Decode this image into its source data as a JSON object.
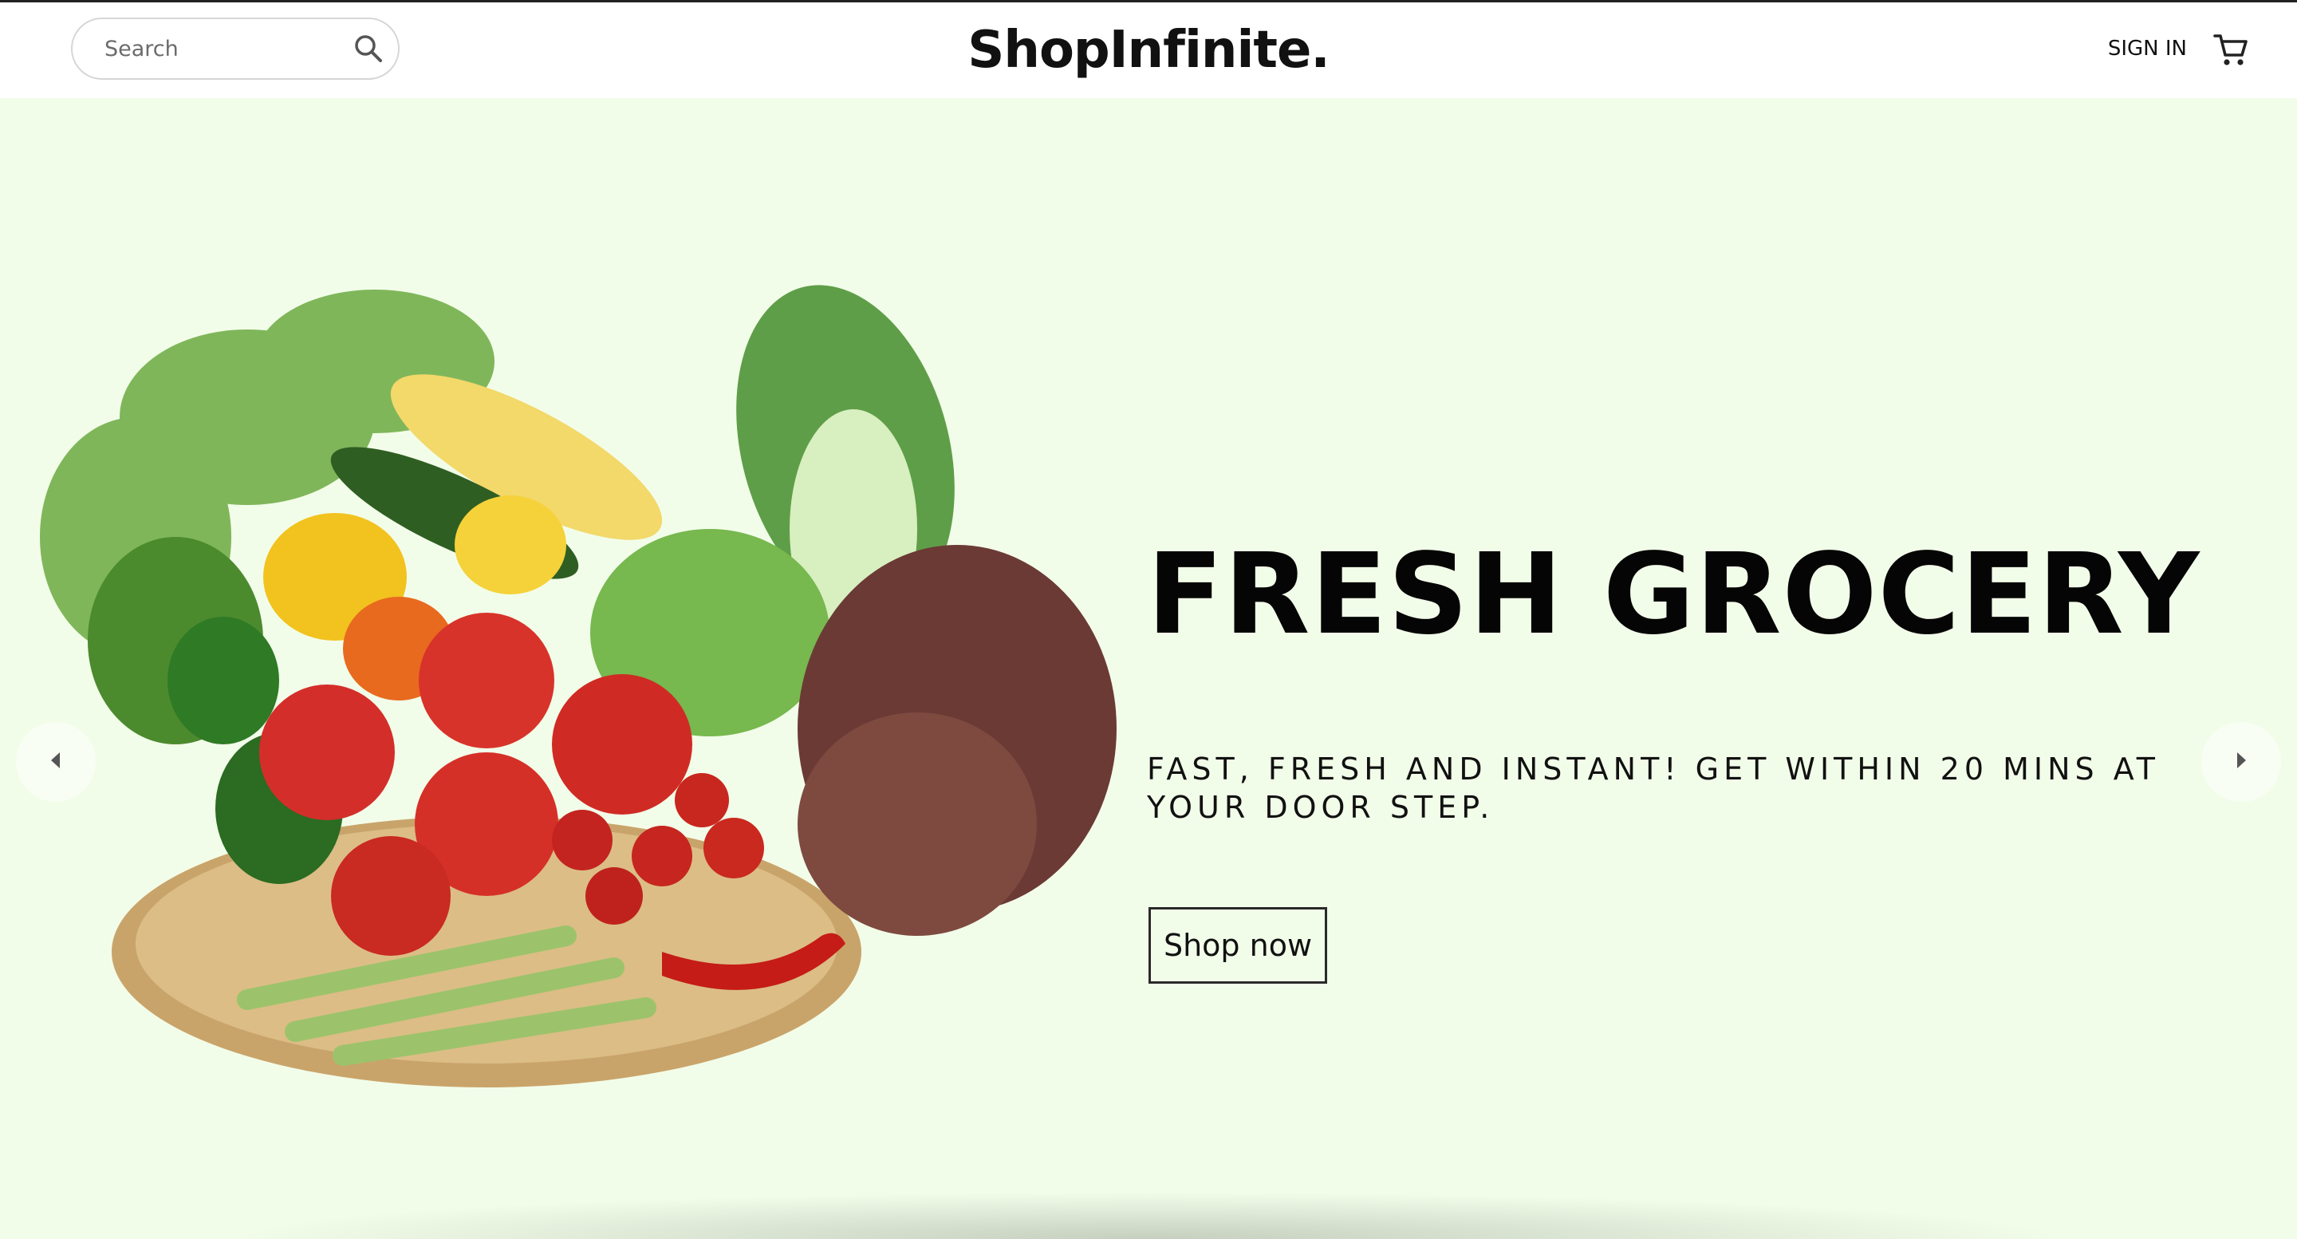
{
  "header": {
    "search_placeholder": "Search",
    "logo": "ShopInfinite.",
    "signin_label": "SIGN IN",
    "icons": {
      "search": "search-icon",
      "cart": "cart-icon"
    }
  },
  "hero": {
    "title": "FRESH GROCERY",
    "subtitle": "FAST, FRESH AND INSTANT! GET WITHIN 20 MINS AT YOUR DOOR STEP.",
    "cta_label": "Shop now",
    "image": "vegetable-basket",
    "arrows": {
      "prev": "chevron-left-icon",
      "next": "chevron-right-icon"
    }
  },
  "colors": {
    "hero_background": "#f2fde9",
    "header_background": "#ffffff",
    "text": "#111111",
    "button_border": "#2a2a2a"
  }
}
